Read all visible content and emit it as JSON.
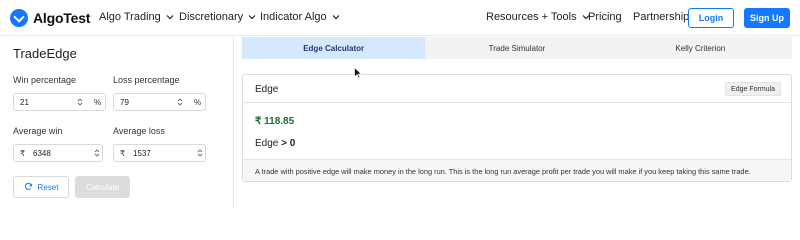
{
  "nav": {
    "logo_text": "AlgoTest",
    "menu": [
      {
        "label": "Algo Trading"
      },
      {
        "label": "Discretionary"
      },
      {
        "label": "Indicator Algo"
      },
      {
        "label": "Resources + Tools"
      },
      {
        "label": "Pricing"
      },
      {
        "label": "Partnership"
      }
    ],
    "login_label": "Login",
    "signup_label": "Sign Up"
  },
  "left_panel": {
    "title": "TradeEdge",
    "win_percentage": {
      "label": "Win percentage",
      "value": "21",
      "unit": "%"
    },
    "loss_percentage": {
      "label": "Loss percentage",
      "value": "79",
      "unit": "%"
    },
    "average_win": {
      "label": "Average win",
      "currency": "₹",
      "value": "6348"
    },
    "average_loss": {
      "label": "Average loss",
      "currency": "₹",
      "value": "1537"
    },
    "reset_label": "Reset",
    "calculate_label": "Calculate"
  },
  "tabs": [
    {
      "label": "Edge Calculator",
      "active": true
    },
    {
      "label": "Trade Simulator",
      "active": false
    },
    {
      "label": "Kelly Criterion",
      "active": false
    }
  ],
  "edge_card": {
    "title": "Edge",
    "formula_button": "Edge Formula",
    "value": "₹ 118.85",
    "status_prefix": "Edge",
    "status_value": "> 0",
    "footer_text": "A trade with positive edge will make money in the long run. This is the long run average profit per trade you will make if you keep taking this same trade."
  },
  "colors": {
    "accent": "#1677ff",
    "edge_positive": "#1e6b2f",
    "active_tab_bg": "#d6e8fb"
  }
}
